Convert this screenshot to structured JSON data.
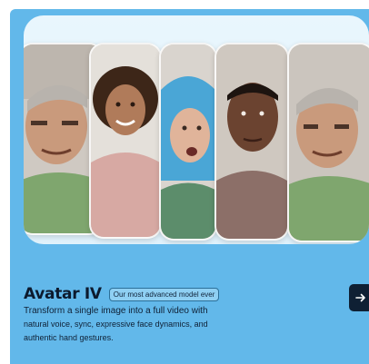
{
  "card": {
    "title": "Avatar IV",
    "badge": "Our most advanced model ever",
    "description_lines": [
      "Transform a single image into a full video with",
      "natural voice, sync, expressive face dynamics, and",
      "authentic hand gestures."
    ],
    "next_icon": "arrow-right-icon"
  },
  "showcase": {
    "avatars": [
      {
        "name": "older-man-avatar",
        "skin": "#c99a7c",
        "hair": "#b8b3ad",
        "shirt": "#7fa66e"
      },
      {
        "name": "curly-hair-woman-avatar",
        "skin": "#b07b5a",
        "hair": "#3d2618",
        "shirt": "#d7a9a3"
      },
      {
        "name": "blue-hair-woman-avatar",
        "skin": "#e0b49a",
        "hair": "#4aa6d6",
        "shirt": "#5c8d6b"
      },
      {
        "name": "man-avatar",
        "skin": "#6b4330",
        "hair": "#1d1410",
        "shirt": "#8c6f68"
      },
      {
        "name": "older-man-repeat-avatar",
        "skin": "#c99a7c",
        "hair": "#b8b3ad",
        "shirt": "#7fa66e"
      }
    ]
  },
  "colors": {
    "card_bg": "#62b8ea",
    "title": "#0c1a2e",
    "button_bg": "#0f2034"
  }
}
